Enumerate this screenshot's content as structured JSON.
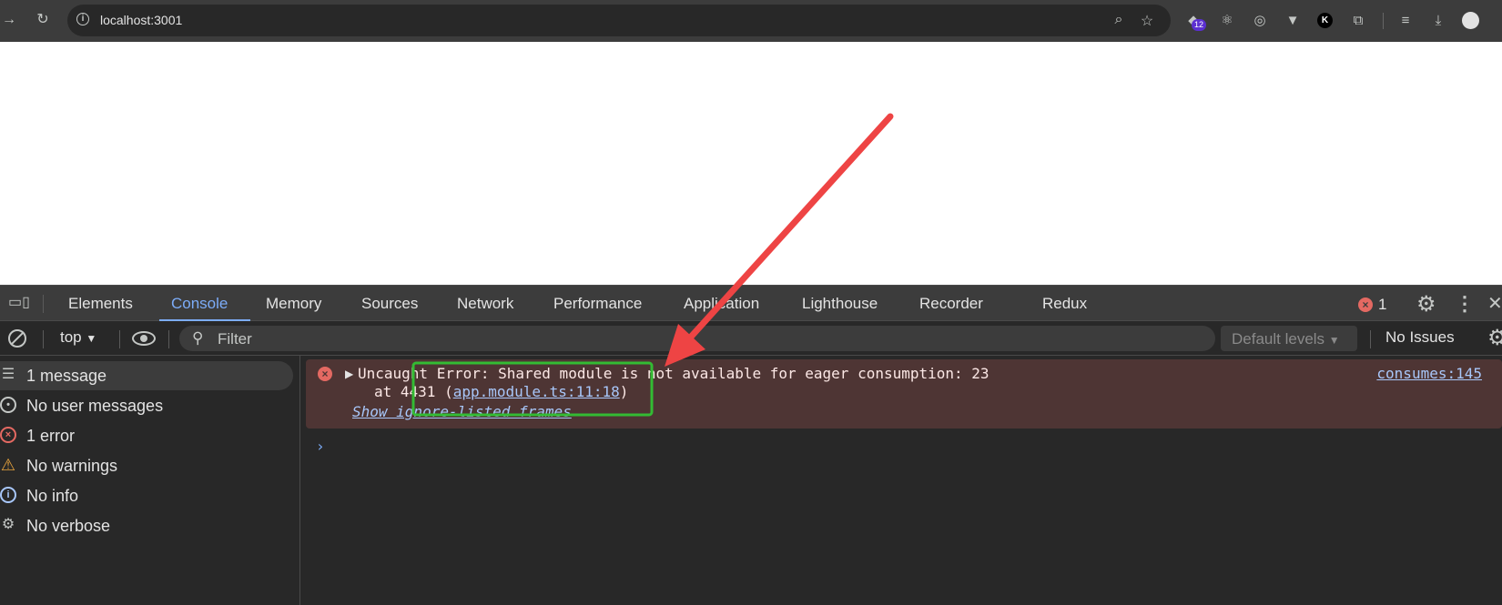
{
  "browser": {
    "url": "localhost:3001",
    "extension_badge": "12",
    "profile_extension_letter": "K"
  },
  "devtools": {
    "tabs": [
      "Elements",
      "Console",
      "Memory",
      "Sources",
      "Network",
      "Performance",
      "Application",
      "Lighthouse",
      "Recorder",
      "Redux"
    ],
    "active_tab": "Console",
    "error_count": "1"
  },
  "console_toolbar": {
    "context": "top",
    "filter_placeholder": "Filter",
    "levels": "Default levels",
    "issues": "No Issues"
  },
  "sidebar": {
    "items": [
      {
        "label": "1 message",
        "icon": "list-icon"
      },
      {
        "label": "No user messages",
        "icon": "user-icon"
      },
      {
        "label": "1 error",
        "icon": "error-icon"
      },
      {
        "label": "No warnings",
        "icon": "warning-icon"
      },
      {
        "label": "No info",
        "icon": "info-icon"
      },
      {
        "label": "No verbose",
        "icon": "bug-icon"
      }
    ]
  },
  "console": {
    "error": {
      "line1": "Uncaught Error: Shared module is not available for eager consumption: 23",
      "line2_prefix": "at 4431 (",
      "line2_link": "app.module.ts:11:18",
      "line2_suffix": ")",
      "source": "consumes:145",
      "ignore_frames": "Show ignore-listed frames"
    }
  },
  "colors": {
    "annotation_arrow": "#ee4444",
    "annotation_box": "#33bb33",
    "accent": "#7cacf8",
    "error": "#e46962"
  }
}
